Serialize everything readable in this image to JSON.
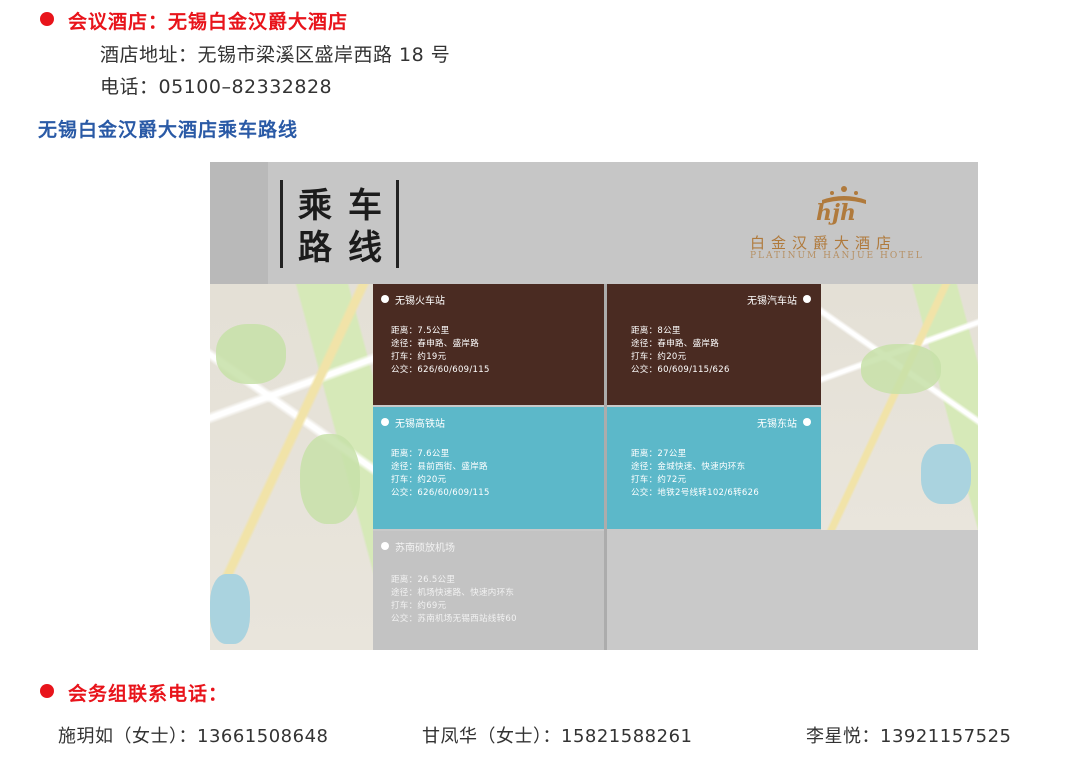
{
  "venue": {
    "heading": "会议酒店：无锡白金汉爵大酒店",
    "address": "酒店地址：无锡市梁溪区盛岸西路 18 号",
    "phone": "电话：05100–82332828"
  },
  "route_heading": "无锡白金汉爵大酒店乘车路线",
  "poster": {
    "title_chars": [
      "乘",
      "车",
      "路",
      "线"
    ],
    "logo_mark": "hjh",
    "logo_cn": "白金汉爵大酒店",
    "logo_en": "PLATINUM HANJUE HOTEL",
    "stations": [
      {
        "name": "无锡火车站",
        "lines": [
          "距离：7.5公里",
          "途径：春申路、盛岸路",
          "打车：约19元",
          "公交：626/60/609/115"
        ]
      },
      {
        "name": "无锡汽车站",
        "lines": [
          "距离：8公里",
          "途径：春申路、盛岸路",
          "打车：约20元",
          "公交：60/609/115/626"
        ]
      },
      {
        "name": "无锡高铁站",
        "lines": [
          "距离：7.6公里",
          "途径：县前西街、盛岸路",
          "打车：约20元",
          "公交：626/60/609/115"
        ]
      },
      {
        "name": "无锡东站",
        "lines": [
          "距离：27公里",
          "途径：金城快速、快速内环东",
          "打车：约72元",
          "公交：地铁2号线转102/6转626"
        ]
      },
      {
        "name": "苏南硕放机场",
        "lines": [
          "距离：26.5公里",
          "途径：机场快速路、快速内环东",
          "打车：约69元",
          "公交：苏南机场无锡西站线转60"
        ]
      }
    ]
  },
  "contacts": {
    "heading": "会务组联系电话：",
    "people": [
      "施玥如（女士）：13661508648",
      "甘凤华（女士）：15821588261",
      "李星悦：13921157525"
    ]
  },
  "colors": {
    "accent_red": "#e8141b",
    "heading_blue": "#2a5aa6",
    "panel_brown": "#4a2b22",
    "panel_teal": "#5cb8c9",
    "logo_gold": "#b07a3c"
  }
}
